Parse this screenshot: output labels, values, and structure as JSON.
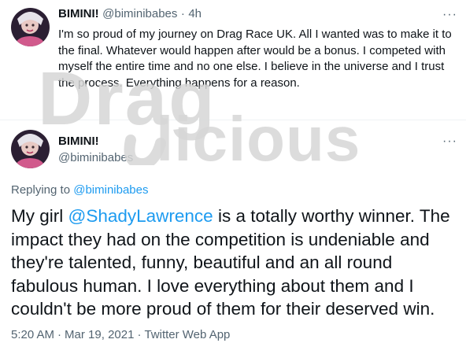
{
  "first_tweet": {
    "display_name": "BIMINI!",
    "handle": "@biminibabes",
    "separator": "·",
    "time": "4h",
    "text": "I'm so proud of my journey on Drag Race UK. All I wanted was to make it to the final. Whatever would happen after would be a bonus. I competed with myself the entire time and no one else. I believe in the universe and I trust the process. Everything happens for a reason.",
    "more_label": "···"
  },
  "main_tweet": {
    "display_name": "BIMINI!",
    "handle": "@biminibabes",
    "more_label": "···",
    "replying_prefix": "Replying to",
    "replying_handle": "@biminibabes",
    "text_before_mention": "My girl ",
    "mention": "@ShadyLawrence",
    "text_after_mention": " is a totally worthy winner. The impact they had on the competition is undeniable and they're talented, funny, beautiful and an all round fabulous human. I love everything about them and I couldn't be more proud of them for their deserved win.",
    "time": "5:20 AM",
    "date": "Mar 19, 2021",
    "source": "Twitter Web App",
    "dot": "·"
  },
  "watermark": {
    "line1": "Drag",
    "line2": "licious"
  },
  "colors": {
    "text": "#0f1419",
    "secondary": "#536471",
    "link": "#1d9bf0",
    "watermark": "#d9d9d9"
  }
}
